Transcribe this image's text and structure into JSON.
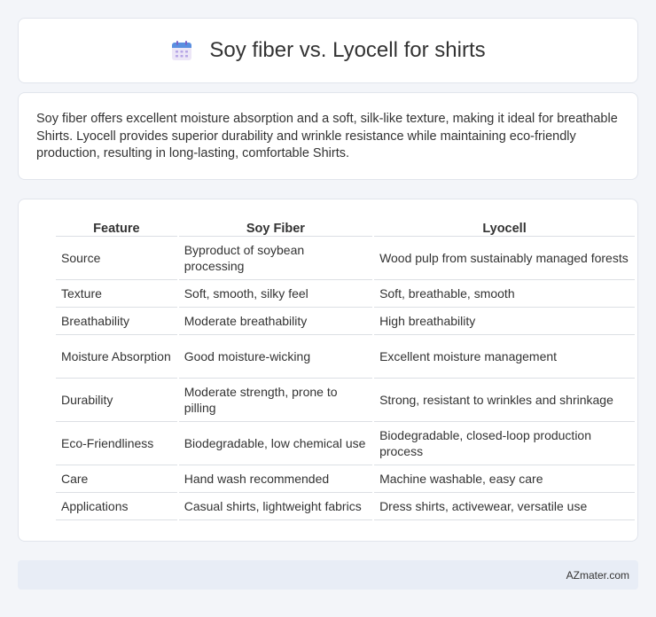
{
  "header": {
    "title": "Soy fiber vs. Lyocell for shirts",
    "icon": "calendar-icon"
  },
  "summary": {
    "text": "Soy fiber offers excellent moisture absorption and a soft, silk-like texture, making it ideal for breathable Shirts. Lyocell provides superior durability and wrinkle resistance while maintaining eco-friendly production, resulting in long-lasting, comfortable Shirts."
  },
  "table": {
    "headers": [
      "Feature",
      "Soy Fiber",
      "Lyocell"
    ],
    "rows": [
      [
        "Source",
        "Byproduct of soybean processing",
        "Wood pulp from sustainably managed forests"
      ],
      [
        "Texture",
        "Soft, smooth, silky feel",
        "Soft, breathable, smooth"
      ],
      [
        "Breathability",
        "Moderate breathability",
        "High breathability"
      ],
      [
        "Moisture Absorption",
        "Good moisture-wicking",
        "Excellent moisture management"
      ],
      [
        "Durability",
        "Moderate strength, prone to pilling",
        "Strong, resistant to wrinkles and shrinkage"
      ],
      [
        "Eco-Friendliness",
        "Biodegradable, low chemical use",
        "Biodegradable, closed-loop production process"
      ],
      [
        "Care",
        "Hand wash recommended",
        "Machine washable, easy care"
      ],
      [
        "Applications",
        "Casual shirts, lightweight fabrics",
        "Dress shirts, activewear, versatile use"
      ]
    ]
  },
  "footer": {
    "text": "AZmater.com"
  }
}
